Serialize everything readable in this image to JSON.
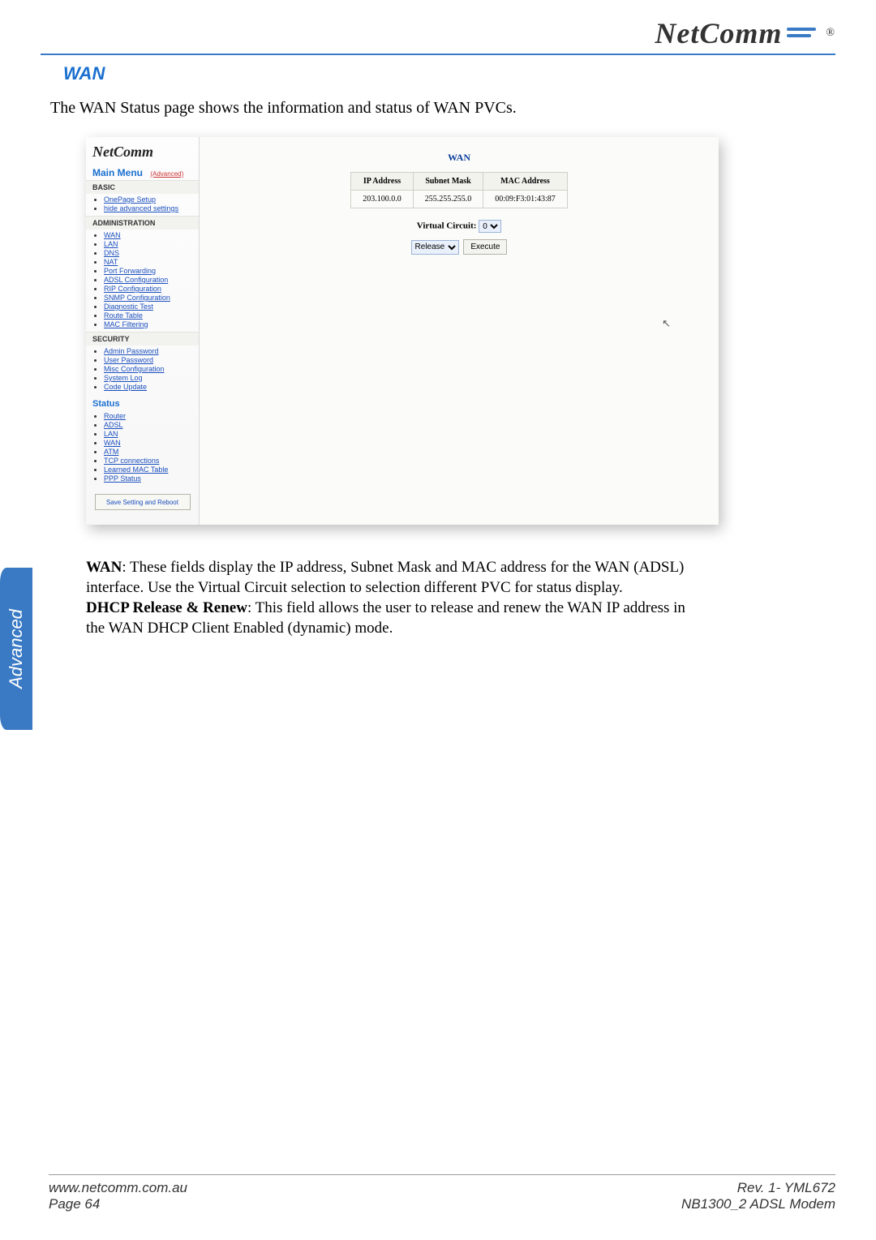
{
  "header": {
    "brand": "NetComm",
    "brand_reg": "®"
  },
  "section_title": "WAN",
  "intro": "The WAN Status page shows the information and status of WAN PVCs.",
  "sidetab": "Advanced",
  "screenshot": {
    "brand_small": "NetComm",
    "main_menu": "Main Menu",
    "main_menu_adv": "(Advanced)",
    "groups": {
      "basic": {
        "label": "BASIC",
        "items": [
          "OnePage Setup",
          "hide advanced settings"
        ]
      },
      "admin": {
        "label": "ADMINISTRATION",
        "items": [
          "WAN",
          "LAN",
          "DNS",
          "NAT",
          "Port Forwarding",
          "ADSL Configuration",
          "RIP Configuration",
          "SNMP Configuration",
          "Diagnostic Test",
          "Route Table",
          "MAC Filtering"
        ]
      },
      "security": {
        "label": "SECURITY",
        "items": [
          "Admin Password",
          "User Password",
          "Misc Configuration",
          "System Log",
          "Code Update"
        ]
      },
      "status": {
        "label": "Status",
        "items": [
          "Router",
          "ADSL",
          "LAN",
          "WAN",
          "ATM",
          "TCP connections",
          "Learned MAC Table",
          "PPP Status"
        ]
      }
    },
    "save_button": "Save Setting and Reboot",
    "content": {
      "title": "WAN",
      "table": {
        "headers": [
          "IP Address",
          "Subnet Mask",
          "MAC Address"
        ],
        "row": [
          "203.100.0.0",
          "255.255.255.0",
          "00:09:F3:01:43:87"
        ]
      },
      "vc_label": "Virtual Circuit:",
      "vc_value": "0",
      "release_value": "Release",
      "execute_label": "Execute"
    }
  },
  "description": {
    "p1_lead": "WAN",
    "p1_body": ":  These fields display the IP address, Subnet Mask and MAC address for the WAN (ADSL) interface. Use the Virtual Circuit selection to selection different PVC for status display.",
    "p2_lead": "DHCP Release & Renew",
    "p2_body": ":  This field allows the user to release and renew the WAN IP address in the WAN DHCP Client Enabled (dynamic) mode."
  },
  "footer": {
    "url": "www.netcomm.com.au",
    "page": "Page 64",
    "rev": "Rev. 1- YML672",
    "model": "NB1300_2 ADSL Modem"
  }
}
